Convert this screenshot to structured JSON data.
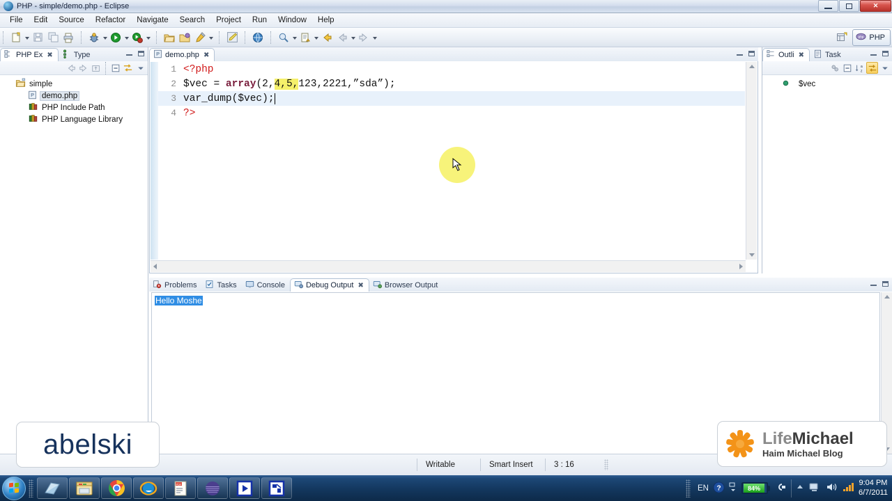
{
  "window": {
    "title": "PHP - simple/demo.php - Eclipse",
    "app_icon": "eclipse-icon",
    "controls": [
      {
        "name": "minimize-button",
        "label": ""
      },
      {
        "name": "restore-button",
        "label": ""
      },
      {
        "name": "close-button",
        "label": "✕"
      }
    ]
  },
  "menubar": {
    "items": [
      {
        "label": "File"
      },
      {
        "label": "Edit"
      },
      {
        "label": "Source"
      },
      {
        "label": "Refactor"
      },
      {
        "label": "Navigate"
      },
      {
        "label": "Search"
      },
      {
        "label": "Project"
      },
      {
        "label": "Run"
      },
      {
        "label": "Window"
      },
      {
        "label": "Help"
      }
    ]
  },
  "toolbar": {
    "groups": [
      {
        "buttons": [
          {
            "name": "new-wizard-button",
            "icon": "new-file-icon",
            "dropdown": true
          },
          {
            "name": "save-button",
            "icon": "save-disk-icon",
            "dropdown": false
          },
          {
            "name": "save-all-button",
            "icon": "save-all-icon",
            "dropdown": false
          },
          {
            "name": "print-button",
            "icon": "printer-icon",
            "dropdown": false
          }
        ]
      },
      {
        "buttons": [
          {
            "name": "debug-button",
            "icon": "debug-bug-icon",
            "dropdown": true
          },
          {
            "name": "run-button",
            "icon": "run-play-icon",
            "dropdown": true
          },
          {
            "name": "profile-button",
            "icon": "profile-icon",
            "dropdown": true
          }
        ]
      },
      {
        "buttons": [
          {
            "name": "open-folder-button",
            "icon": "open-folder-icon",
            "dropdown": false
          },
          {
            "name": "open-project-button",
            "icon": "project-folder-icon",
            "dropdown": false
          },
          {
            "name": "edit-pencil-button",
            "icon": "pencil-icon",
            "dropdown": true
          }
        ]
      },
      {
        "buttons": [
          {
            "name": "highlighter-button",
            "icon": "highlighter-icon",
            "dropdown": false
          }
        ]
      },
      {
        "buttons": [
          {
            "name": "open-browser-button",
            "icon": "globe-icon",
            "dropdown": false
          }
        ]
      },
      {
        "buttons": [
          {
            "name": "search-resource-button",
            "icon": "search-magnifier-icon",
            "dropdown": true
          },
          {
            "name": "next-annotation-button",
            "icon": "next-annotation-icon",
            "dropdown": true
          },
          {
            "name": "back-navigation-button",
            "icon": "back-arrow-icon",
            "dropdown": false
          },
          {
            "name": "previous-edit-button",
            "icon": "previous-edit-icon",
            "dropdown": true
          },
          {
            "name": "forward-navigation-button",
            "icon": "forward-arrow-icon",
            "dropdown": true
          }
        ]
      }
    ],
    "perspective": {
      "open_perspective_icon": "open-perspective-icon",
      "active": "PHP",
      "active_icon": "php-perspective-icon"
    }
  },
  "php_explorer": {
    "tabs": [
      {
        "label": "PHP Ex",
        "icon": "php-explorer-icon",
        "active": true,
        "closeable": true
      },
      {
        "label": "Type",
        "icon": "type-hierarchy-icon",
        "active": false,
        "closeable": false
      }
    ],
    "view_toolbar": [
      {
        "name": "back-button",
        "icon": "back-arrow-icon"
      },
      {
        "name": "forward-button",
        "icon": "forward-arrow-icon"
      },
      {
        "name": "up-button",
        "icon": "up-level-icon"
      },
      {
        "name": "collapse-all-button",
        "icon": "collapse-all-icon"
      },
      {
        "name": "link-with-editor-button",
        "icon": "link-editor-icon"
      },
      {
        "name": "view-menu-button",
        "icon": "chevron-down-icon"
      }
    ],
    "tree": [
      {
        "label": "simple",
        "icon": "project-folder-icon",
        "level": 0,
        "selected": false
      },
      {
        "label": "demo.php",
        "icon": "php-file-icon",
        "level": 1,
        "selected": true
      },
      {
        "label": "PHP Include Path",
        "icon": "library-books-icon",
        "level": 1,
        "selected": false
      },
      {
        "label": "PHP Language Library",
        "icon": "library-books-icon",
        "level": 1,
        "selected": false
      }
    ]
  },
  "editor": {
    "tab": {
      "label": "demo.php",
      "icon": "php-file-icon",
      "close": "✕"
    },
    "frame_buttons": [
      {
        "name": "minimize-editor-button"
      },
      {
        "name": "maximize-editor-button"
      }
    ],
    "lines": [
      {
        "num": "1",
        "tokens": [
          {
            "t": "<?php",
            "c": "k-tag"
          }
        ]
      },
      {
        "num": "2",
        "tokens": [
          {
            "t": "$vec = ",
            "c": "k-txt"
          },
          {
            "t": "array",
            "c": "k-fn"
          },
          {
            "t": "(2,",
            "c": "k-txt"
          },
          {
            "t": "4,",
            "c": "k-txt hl"
          },
          {
            "t": "5,",
            "c": "k-txt hl"
          },
          {
            "t": "123,2221,”sda”);",
            "c": "k-txt"
          }
        ]
      },
      {
        "num": "3",
        "current": true,
        "tokens": [
          {
            "t": "var_dump($vec);",
            "c": "k-txt"
          }
        ],
        "caret": true
      },
      {
        "num": "4",
        "tokens": [
          {
            "t": "?>",
            "c": "k-tag"
          }
        ]
      }
    ]
  },
  "outline": {
    "tabs": [
      {
        "label": "Outli",
        "icon": "outline-icon",
        "active": true,
        "closeable": true
      },
      {
        "label": "Task",
        "icon": "task-list-icon",
        "active": false,
        "closeable": false
      }
    ],
    "view_toolbar": [
      {
        "name": "hide-fields-button",
        "icon": "hide-fields-icon"
      },
      {
        "name": "collapse-all-button",
        "icon": "collapse-all-icon"
      },
      {
        "name": "sort-alphabetically-button",
        "icon": "sort-az-icon"
      },
      {
        "name": "link-with-editor-button",
        "icon": "link-editor-icon",
        "toggled": true
      },
      {
        "name": "view-menu-button",
        "icon": "chevron-down-icon"
      }
    ],
    "items": [
      {
        "label": "$vec",
        "icon": "variable-dot-icon"
      }
    ],
    "frame_buttons": [
      {
        "name": "minimize-outline-button"
      },
      {
        "name": "maximize-outline-button"
      }
    ]
  },
  "console": {
    "tabs": [
      {
        "label": "Problems",
        "icon": "problems-icon",
        "active": false,
        "closeable": false
      },
      {
        "label": "Tasks",
        "icon": "tasks-icon",
        "active": false,
        "closeable": false
      },
      {
        "label": "Console",
        "icon": "console-icon",
        "active": false,
        "closeable": false
      },
      {
        "label": "Debug Output",
        "icon": "debug-output-icon",
        "active": true,
        "closeable": true
      },
      {
        "label": "Browser Output",
        "icon": "browser-output-icon",
        "active": false,
        "closeable": false
      }
    ],
    "output_text": "Hello Moshe",
    "output_selected": true,
    "frame_buttons": [
      {
        "name": "minimize-console-button"
      },
      {
        "name": "maximize-console-button"
      }
    ]
  },
  "statusbar": {
    "writable": "Writable",
    "insert_mode": "Smart Insert",
    "position": "3 : 16"
  },
  "watermarks": {
    "abelski": "abelski",
    "lifemichael_life": "Life",
    "lifemichael_michael": "Michael",
    "lifemichael_sub": "Haim Michael Blog"
  },
  "taskbar": {
    "start_icon": "windows-start-orb",
    "items": [
      {
        "name": "taskbar-item-notepad",
        "icon": "notepad-icon"
      },
      {
        "name": "taskbar-item-explorer",
        "icon": "folder-explorer-icon"
      },
      {
        "name": "taskbar-item-chrome",
        "icon": "chrome-icon"
      },
      {
        "name": "taskbar-item-internet-explorer",
        "icon": "internet-explorer-icon"
      },
      {
        "name": "taskbar-item-pdf",
        "icon": "pdf-document-icon"
      },
      {
        "name": "taskbar-item-sphere",
        "icon": "purple-sphere-icon"
      },
      {
        "name": "taskbar-item-player",
        "icon": "play-button-icon"
      },
      {
        "name": "taskbar-item-eclipse",
        "icon": "eclipse-app-icon"
      }
    ],
    "tray": {
      "language": "EN",
      "help_icon": "help-question-icon",
      "battery_percent": "84%",
      "power_icon": "power-plug-icon",
      "show_hidden_icon": "chevron-up-icon",
      "network_icon": "network-icon",
      "volume_icon": "speaker-icon",
      "signal_icon": "signal-bars-icon",
      "time": "9:04 PM",
      "date": "6/7/2011"
    }
  },
  "colors": {
    "accent": "#2f8de4",
    "tag": "#d11a1a",
    "function": "#7a1f3d",
    "highlight": "#f5f06a",
    "orange": "#f39318",
    "navy": "#16325c"
  }
}
